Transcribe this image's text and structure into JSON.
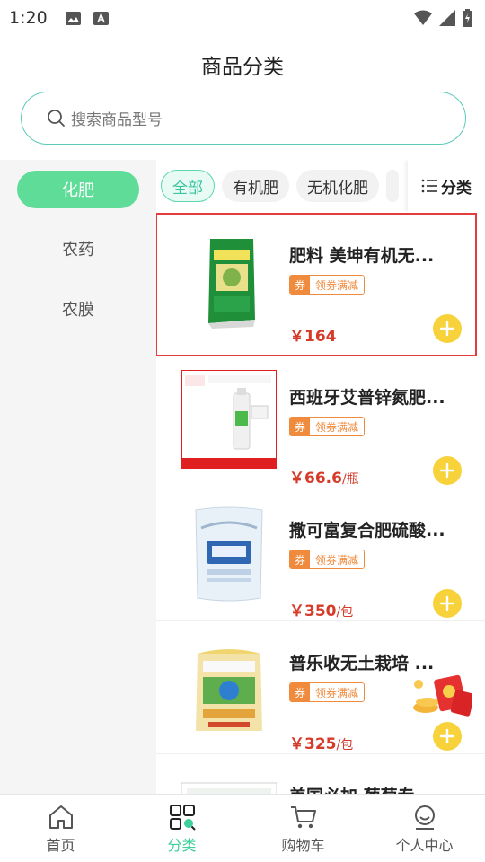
{
  "status": {
    "time": "1:20"
  },
  "header": {
    "title": "商品分类"
  },
  "search": {
    "placeholder": "搜索商品型号"
  },
  "sidebar": {
    "items": [
      {
        "label": "化肥",
        "active": true
      },
      {
        "label": "农药",
        "active": false
      },
      {
        "label": "农膜",
        "active": false
      }
    ]
  },
  "tabs": {
    "items": [
      {
        "label": "全部",
        "active": true
      },
      {
        "label": "有机肥",
        "active": false
      },
      {
        "label": "无机化肥",
        "active": false
      }
    ],
    "filter_label": "分类"
  },
  "products": [
    {
      "name": "肥料 美坤有机无...",
      "coupon_tag": "券",
      "coupon_text": "领券满减",
      "price_symbol": "￥",
      "price": "164",
      "unit": ""
    },
    {
      "name": "西班牙艾普锌氮肥...",
      "coupon_tag": "券",
      "coupon_text": "领券满减",
      "price_symbol": "￥",
      "price": "66.6",
      "unit": "/瓶"
    },
    {
      "name": "撒可富复合肥硫酸...",
      "coupon_tag": "券",
      "coupon_text": "领券满减",
      "price_symbol": "￥",
      "price": "350",
      "unit": "/包"
    },
    {
      "name": "普乐收无土栽培 ...",
      "coupon_tag": "券",
      "coupon_text": "领券满减",
      "price_symbol": "￥",
      "price": "325",
      "unit": "/包"
    },
    {
      "name": "美国必加 葡萄专..."
    }
  ],
  "nav": {
    "items": [
      {
        "label": "首页",
        "icon": "home-icon"
      },
      {
        "label": "分类",
        "icon": "category-icon",
        "active": true
      },
      {
        "label": "购物车",
        "icon": "cart-icon"
      },
      {
        "label": "个人中心",
        "icon": "profile-icon"
      }
    ]
  },
  "colors": {
    "accent": "#3fcf9b",
    "sidebar_active": "#5fdc98",
    "price": "#d63b2a",
    "coupon": "#f08a3c",
    "add_button": "#f8d23a",
    "highlight": "#e43b3b"
  }
}
